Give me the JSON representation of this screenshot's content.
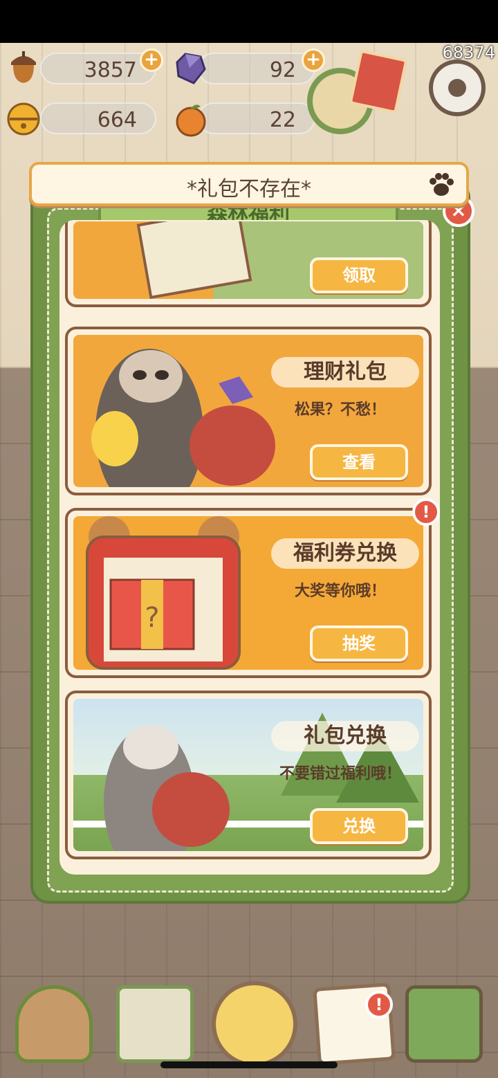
{
  "score": "68374",
  "resources": {
    "acorns": "3857",
    "gems": "92",
    "bells": "664",
    "oranges": "22",
    "plus": "+"
  },
  "toast": {
    "text": "*礼包不存在*"
  },
  "panel": {
    "title": "森林福利",
    "close": "×",
    "cards": [
      {
        "button": "领取"
      },
      {
        "label": "理财礼包",
        "subtitle": "松果？不愁！",
        "button": "查看"
      },
      {
        "label": "福利券兑换",
        "subtitle": "大奖等你哦！",
        "button": "抽奖"
      },
      {
        "label": "礼包兑换",
        "subtitle": "不要错过福利哦！",
        "button": "兑换"
      }
    ]
  },
  "badges": {
    "alert": "!"
  },
  "icons": [
    "acorn-icon",
    "gem-icon",
    "bell-icon",
    "orange-icon",
    "settings-gear-icon",
    "paw-icon",
    "close-icon",
    "home-icon",
    "mail-icon",
    "hero-icon",
    "task-list-icon",
    "map-icon"
  ],
  "colors": {
    "panel_green": "#6f9245",
    "button_orange": "#f6b642",
    "toast_border": "#e7a647",
    "alert_red": "#e25a45"
  }
}
